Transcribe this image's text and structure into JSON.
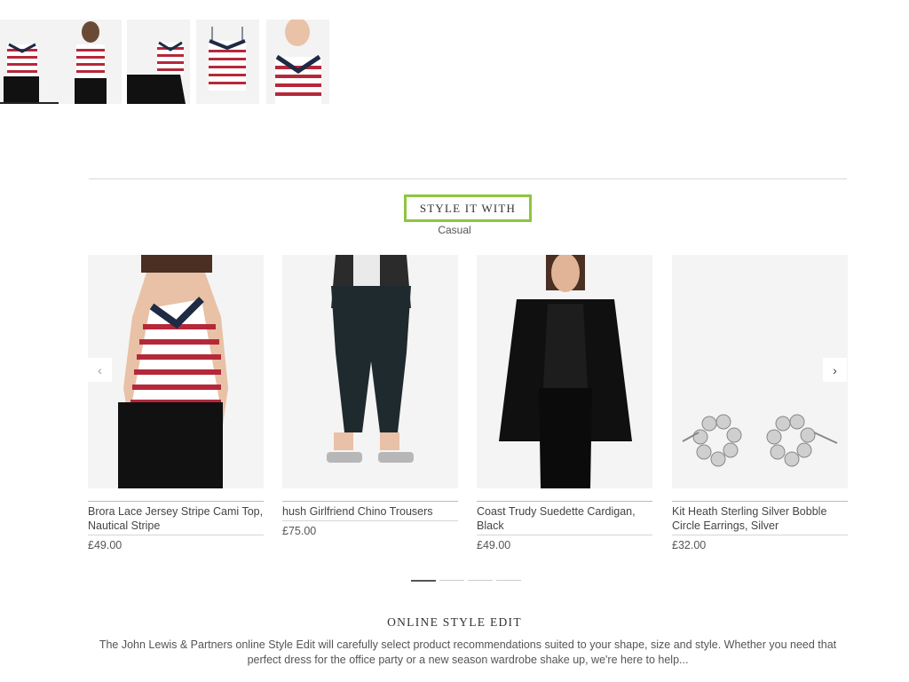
{
  "thumbnails": [
    {
      "view": "front",
      "active": true
    },
    {
      "view": "back",
      "active": false
    },
    {
      "view": "seated",
      "active": false
    },
    {
      "view": "flat",
      "active": false
    },
    {
      "view": "detail",
      "active": false
    }
  ],
  "style_section": {
    "title": "STYLE IT WITH",
    "subtitle": "Casual",
    "highlight_color": "#8cc63f"
  },
  "carousel": {
    "prev_icon": "chevron-left-icon",
    "next_icon": "chevron-right-icon",
    "prev_glyph": "‹",
    "next_glyph": "›",
    "page_count": 4,
    "active_page": 1
  },
  "products": [
    {
      "name": "Brora Lace Jersey Stripe Cami Top, Nautical Stripe",
      "price": "£49.00",
      "image": "striped cami top"
    },
    {
      "name": "hush Girlfriend Chino Trousers",
      "price": "£75.00",
      "image": "dark chino trousers"
    },
    {
      "name": "Coast Trudy Suedette Cardigan, Black",
      "price": "£49.00",
      "image": "black cardigan"
    },
    {
      "name": "Kit Heath Sterling Silver Bobble Circle Earrings, Silver",
      "price": "£32.00",
      "image": "silver bobble earrings"
    }
  ],
  "online_edit": {
    "title": "ONLINE STYLE EDIT",
    "text": "The John Lewis & Partners online Style Edit will carefully select product recommendations suited to your shape, size and style. Whether you need that perfect dress for the office party or a new season wardrobe shake up, we're here to help..."
  },
  "colors": {
    "stripe_red": "#b5283a",
    "navy_lace": "#1f2a44",
    "black": "#111111"
  }
}
